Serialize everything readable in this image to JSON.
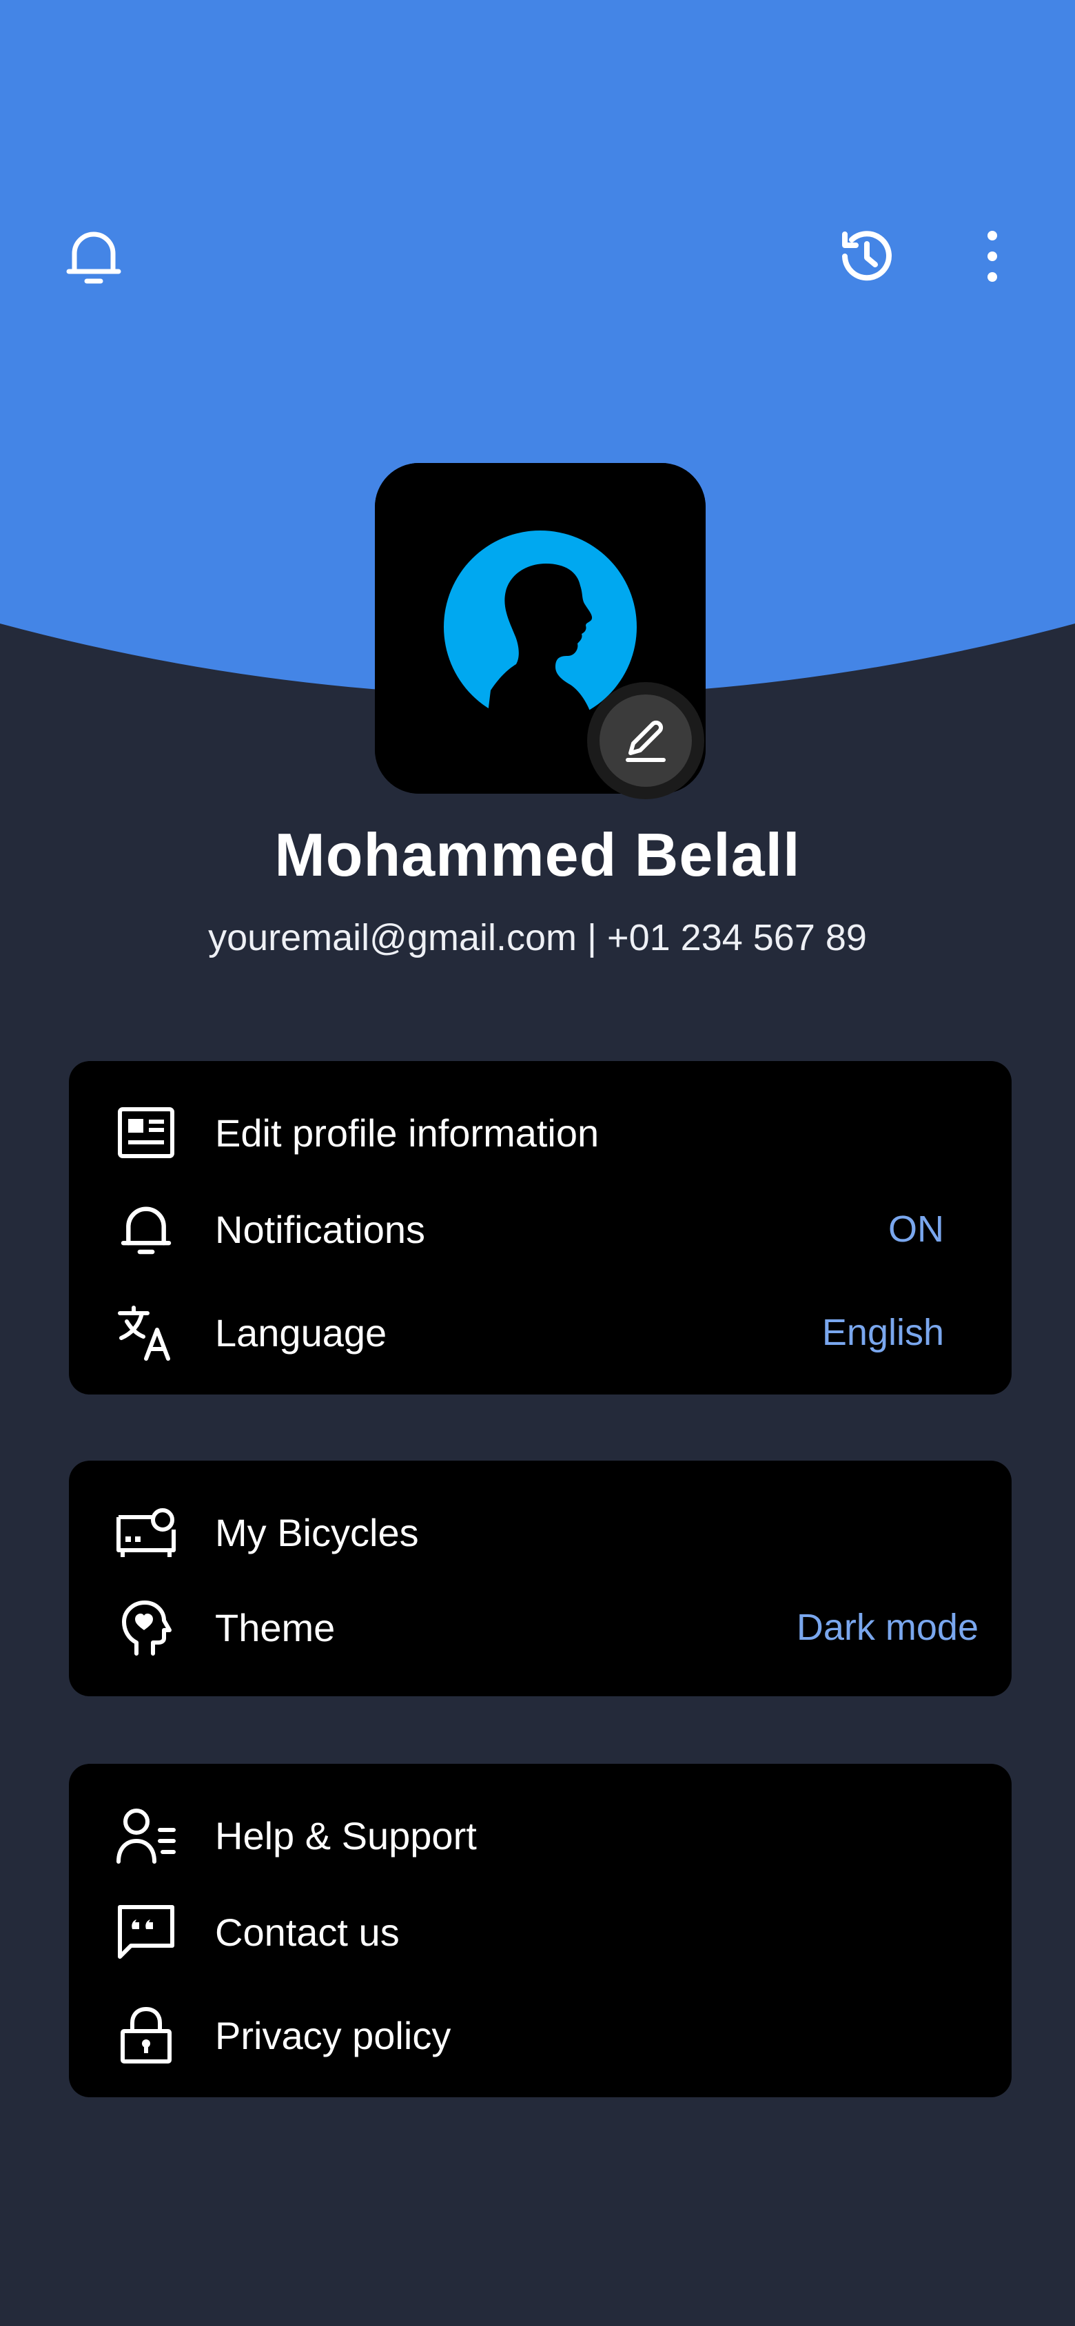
{
  "colors": {
    "header_blue": "#4485e6",
    "background": "#242a3a",
    "card": "#000000",
    "accent_value": "#7aa7ee",
    "avatar_circle": "#00a8f0"
  },
  "top_bar": {
    "left_icon": "bell-outline-icon",
    "right_icons": [
      "history-icon",
      "more-vertical-icon"
    ]
  },
  "profile": {
    "name": "Mohammed Belall",
    "contact": "youremail@gmail.com | +01 234 567 89",
    "edit_icon": "pencil-icon"
  },
  "cards": [
    {
      "items": [
        {
          "icon": "profile-card-icon",
          "label": "Edit profile information",
          "value": ""
        },
        {
          "icon": "bell-outline-icon",
          "label": "Notifications",
          "value": "ON"
        },
        {
          "icon": "translate-icon",
          "label": "Language",
          "value": "English"
        }
      ]
    },
    {
      "items": [
        {
          "icon": "bicycle-device-icon",
          "label": "My Bicycles",
          "value": ""
        },
        {
          "icon": "head-heart-icon",
          "label": "Theme",
          "value": "Dark mode"
        }
      ]
    },
    {
      "items": [
        {
          "icon": "support-user-icon",
          "label": "Help & Support",
          "value": ""
        },
        {
          "icon": "quote-chat-icon",
          "label": "Contact us",
          "value": ""
        },
        {
          "icon": "lock-icon",
          "label": "Privacy policy",
          "value": ""
        }
      ]
    }
  ]
}
